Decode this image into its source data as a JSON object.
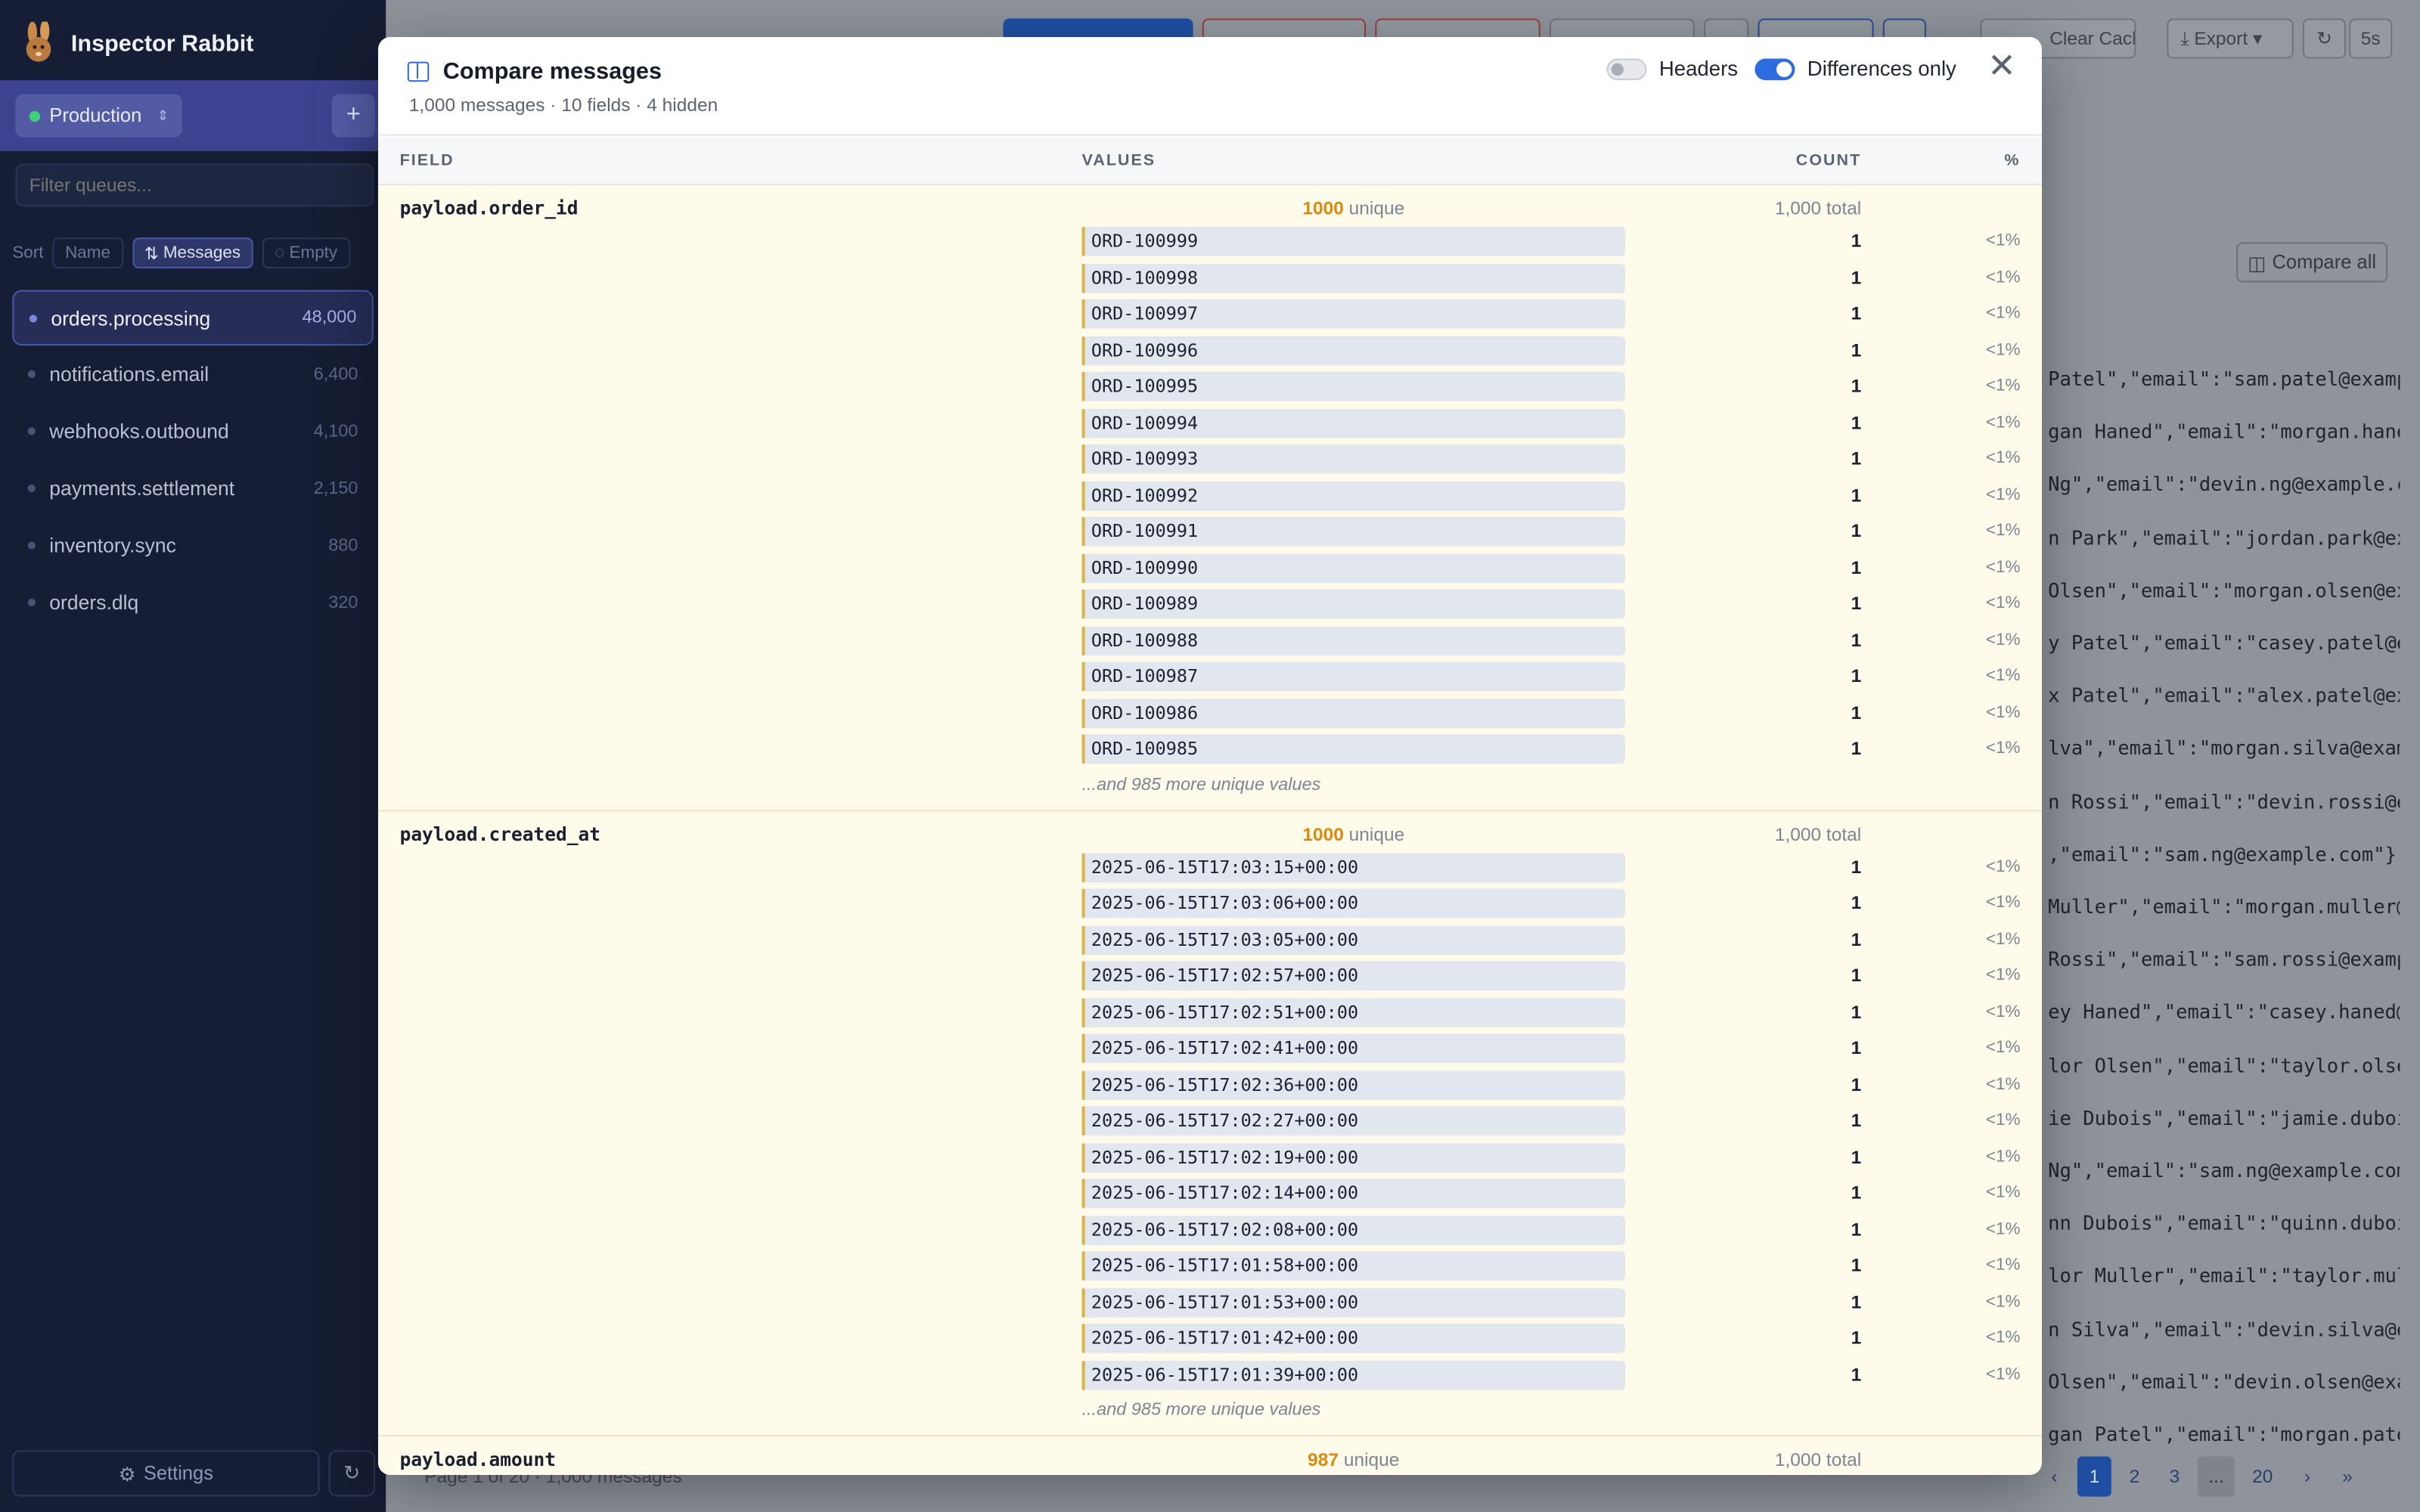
{
  "app": {
    "name": "Inspector Rabbit"
  },
  "sidebar": {
    "environment": "Production",
    "filter_placeholder": "Filter queues...",
    "sort_label": "Sort",
    "sort_options": [
      {
        "label": "Name",
        "active": false
      },
      {
        "label": "Messages",
        "active": true
      },
      {
        "label": "Empty",
        "active": false
      }
    ],
    "queues": [
      {
        "name": "orders.processing",
        "count": "48,000",
        "active": true
      },
      {
        "name": "notifications.email",
        "count": "6,400",
        "active": false
      },
      {
        "name": "webhooks.outbound",
        "count": "4,100",
        "active": false
      },
      {
        "name": "payments.settlement",
        "count": "2,150",
        "active": false
      },
      {
        "name": "inventory.sync",
        "count": "880",
        "active": false
      },
      {
        "name": "orders.dlq",
        "count": "320",
        "active": false
      }
    ],
    "settings_label": "Settings"
  },
  "toolbar": {
    "export_label": "Export",
    "clear_cache_label": "Clear Cache",
    "interval": "5s"
  },
  "main": {
    "compare_all_label": "Compare all",
    "bg_lines": [
      " Patel\",\"email\":\"sam.patel@examp",
      "gan Haned\",\"email\":\"morgan.haned",
      " Ng\",\"email\":\"devin.ng@example.c",
      "n Park\",\"email\":\"jordan.park@exa",
      "Olsen\",\"email\":\"morgan.olsen@exa",
      "y Patel\",\"email\":\"casey.patel@ex",
      "x Patel\",\"email\":\"alex.patel@exa",
      "lva\",\"email\":\"morgan.silva@examp",
      "n Rossi\",\"email\":\"devin.rossi@ex",
      ",\"email\":\"sam.ng@example.com\"},\"",
      "Muller\",\"email\":\"morgan.muller@e",
      " Rossi\",\"email\":\"sam.rossi@examp",
      "ey Haned\",\"email\":\"casey.haned@e",
      "lor Olsen\",\"email\":\"taylor.olsen",
      "ie Dubois\",\"email\":\"jamie.dubois",
      " Ng\",\"email\":\"sam.ng@example.com",
      "nn Dubois\",\"email\":\"quinn.dubois",
      "lor Muller\",\"email\":\"taylor.mull",
      "n Silva\",\"email\":\"devin.silva@ex",
      " Olsen\",\"email\":\"devin.olsen@exa",
      "gan Patel\",\"email\":\"morgan.patel"
    ],
    "page_info": "Page 1 of 20 · 1,000 messages",
    "pages": [
      "1",
      "2",
      "3",
      "...",
      "20"
    ]
  },
  "modal": {
    "title": "Compare messages",
    "subtitle": "1,000 messages · 10 fields · 4 hidden",
    "headers_toggle": {
      "label": "Headers",
      "on": false
    },
    "diff_toggle": {
      "label": "Differences only",
      "on": true
    },
    "columns": {
      "field": "FIELD",
      "values": "VALUES",
      "count": "COUNT",
      "pct": "%"
    },
    "unique_word": "unique",
    "fields": [
      {
        "name": "payload.order_id",
        "unique": "1000",
        "total": "1,000 total",
        "rows": [
          {
            "value": "ORD-100999",
            "count": "1",
            "pct": "<1%"
          },
          {
            "value": "ORD-100998",
            "count": "1",
            "pct": "<1%"
          },
          {
            "value": "ORD-100997",
            "count": "1",
            "pct": "<1%"
          },
          {
            "value": "ORD-100996",
            "count": "1",
            "pct": "<1%"
          },
          {
            "value": "ORD-100995",
            "count": "1",
            "pct": "<1%"
          },
          {
            "value": "ORD-100994",
            "count": "1",
            "pct": "<1%"
          },
          {
            "value": "ORD-100993",
            "count": "1",
            "pct": "<1%"
          },
          {
            "value": "ORD-100992",
            "count": "1",
            "pct": "<1%"
          },
          {
            "value": "ORD-100991",
            "count": "1",
            "pct": "<1%"
          },
          {
            "value": "ORD-100990",
            "count": "1",
            "pct": "<1%"
          },
          {
            "value": "ORD-100989",
            "count": "1",
            "pct": "<1%"
          },
          {
            "value": "ORD-100988",
            "count": "1",
            "pct": "<1%"
          },
          {
            "value": "ORD-100987",
            "count": "1",
            "pct": "<1%"
          },
          {
            "value": "ORD-100986",
            "count": "1",
            "pct": "<1%"
          },
          {
            "value": "ORD-100985",
            "count": "1",
            "pct": "<1%"
          }
        ],
        "more": "...and 985 more unique values"
      },
      {
        "name": "payload.created_at",
        "unique": "1000",
        "total": "1,000 total",
        "rows": [
          {
            "value": "2025-06-15T17:03:15+00:00",
            "count": "1",
            "pct": "<1%"
          },
          {
            "value": "2025-06-15T17:03:06+00:00",
            "count": "1",
            "pct": "<1%"
          },
          {
            "value": "2025-06-15T17:03:05+00:00",
            "count": "1",
            "pct": "<1%"
          },
          {
            "value": "2025-06-15T17:02:57+00:00",
            "count": "1",
            "pct": "<1%"
          },
          {
            "value": "2025-06-15T17:02:51+00:00",
            "count": "1",
            "pct": "<1%"
          },
          {
            "value": "2025-06-15T17:02:41+00:00",
            "count": "1",
            "pct": "<1%"
          },
          {
            "value": "2025-06-15T17:02:36+00:00",
            "count": "1",
            "pct": "<1%"
          },
          {
            "value": "2025-06-15T17:02:27+00:00",
            "count": "1",
            "pct": "<1%"
          },
          {
            "value": "2025-06-15T17:02:19+00:00",
            "count": "1",
            "pct": "<1%"
          },
          {
            "value": "2025-06-15T17:02:14+00:00",
            "count": "1",
            "pct": "<1%"
          },
          {
            "value": "2025-06-15T17:02:08+00:00",
            "count": "1",
            "pct": "<1%"
          },
          {
            "value": "2025-06-15T17:01:58+00:00",
            "count": "1",
            "pct": "<1%"
          },
          {
            "value": "2025-06-15T17:01:53+00:00",
            "count": "1",
            "pct": "<1%"
          },
          {
            "value": "2025-06-15T17:01:42+00:00",
            "count": "1",
            "pct": "<1%"
          },
          {
            "value": "2025-06-15T17:01:39+00:00",
            "count": "1",
            "pct": "<1%"
          }
        ],
        "more": "...and 985 more unique values"
      },
      {
        "name": "payload.amount",
        "unique": "987",
        "total": "1,000 total",
        "rows": [],
        "more": ""
      }
    ]
  }
}
